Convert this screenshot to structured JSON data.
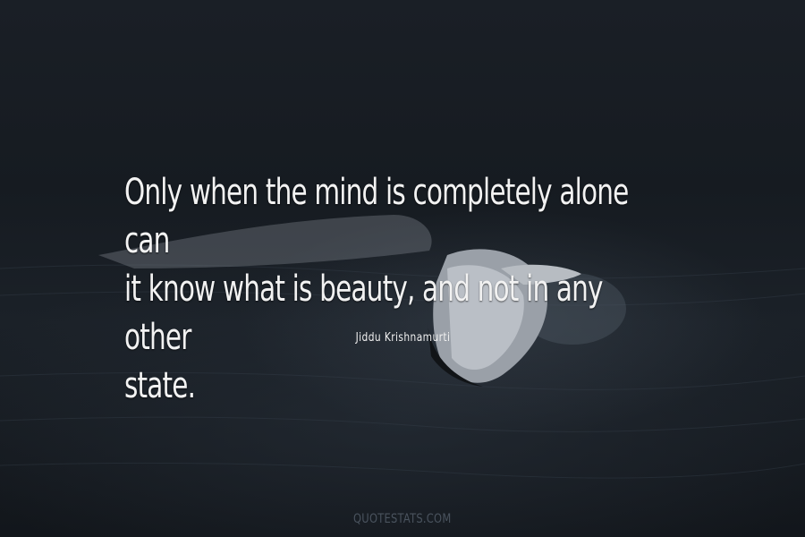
{
  "quote": {
    "lines": [
      "Only when the mind is completely alone can",
      "it know what is beauty, and not in any other",
      "state."
    ]
  },
  "author": "Jiddu Krishnamurti",
  "watermark": "QUOTESTATS.COM"
}
